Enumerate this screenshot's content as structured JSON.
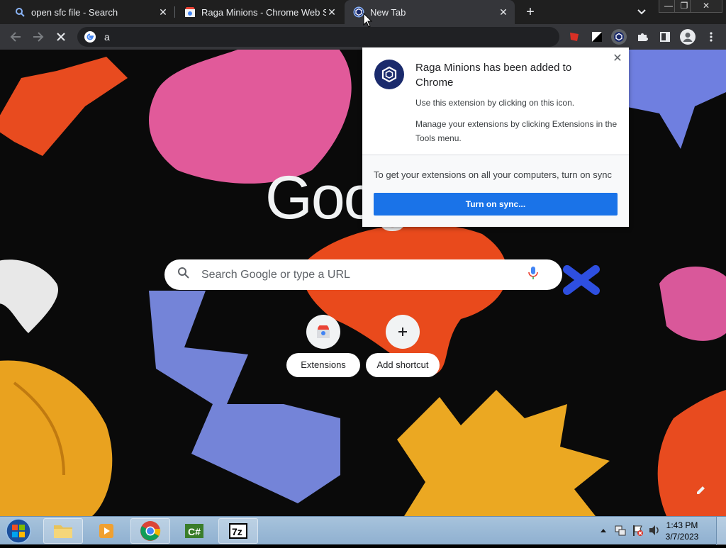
{
  "tabs": [
    {
      "title": "open sfc file - Search",
      "icon": "search-icon"
    },
    {
      "title": "Raga Minions - Chrome Web Store",
      "icon": "web-store-icon"
    },
    {
      "title": "New Tab",
      "icon": "extension-hex-icon"
    }
  ],
  "window_controls": {
    "minimize": "—",
    "restore": "❐",
    "close": "✕"
  },
  "omnibox": {
    "value": "a"
  },
  "ntp": {
    "logo_text": "Google",
    "search_placeholder": "Search Google or type a URL",
    "shortcuts": [
      {
        "label": "Extensions",
        "icon": "web-store-icon"
      },
      {
        "label": "Add shortcut",
        "icon": "plus-icon"
      }
    ]
  },
  "bubble": {
    "title": "Raga Minions has been added to Chrome",
    "desc1": "Use this extension by clicking on this icon.",
    "desc2": "Manage your extensions by clicking Extensions in the Tools menu.",
    "sync_text": "To get your extensions on all your computers, turn on sync",
    "sync_button": "Turn on sync..."
  },
  "taskbar": {
    "time": "1:43 PM",
    "date": "3/7/2023",
    "apps": [
      "file-explorer-icon",
      "media-player-icon",
      "chrome-icon",
      "csharp-icon",
      "7zip-icon"
    ]
  },
  "colors": {
    "accent_blue": "#1a73e8",
    "tab_strip": "#1f1f1f",
    "toolbar": "#35363a",
    "extension_icon_bg": "#1a2a6c"
  }
}
